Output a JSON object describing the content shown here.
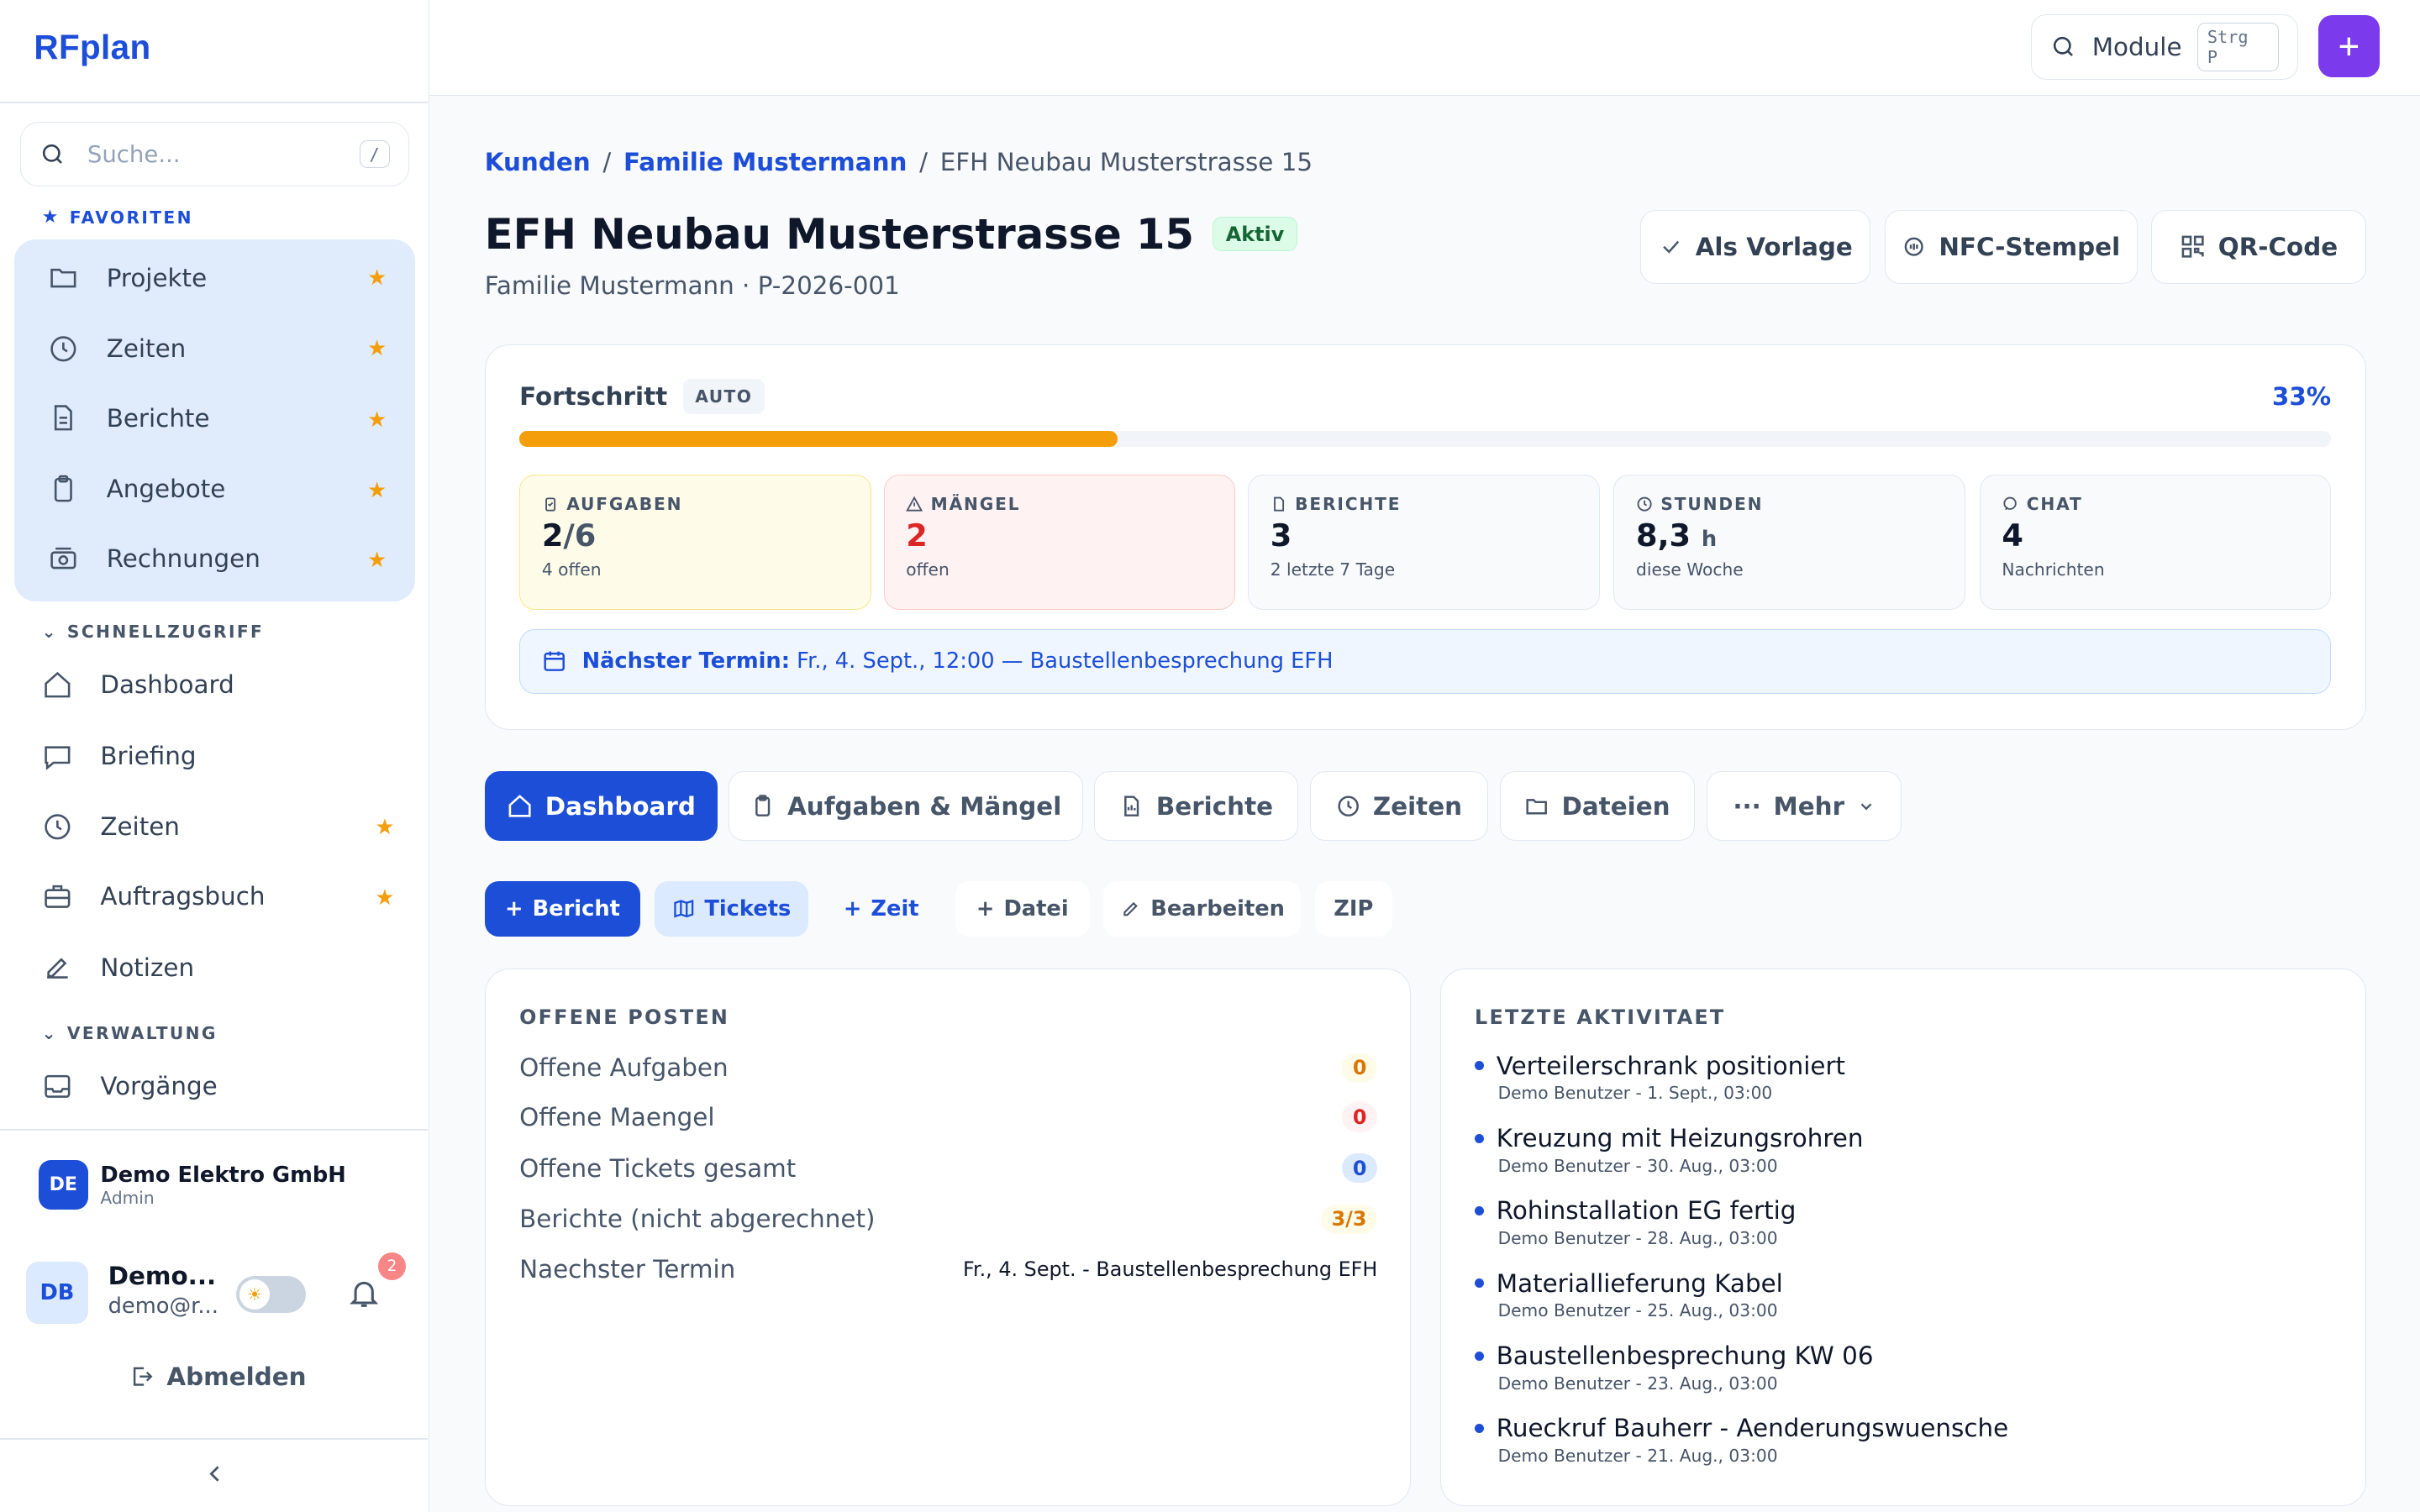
{
  "app": {
    "name": "RFplan"
  },
  "sidebar": {
    "search_placeholder": "Suche...",
    "search_shortcut": "/",
    "favorites_label": "FAVORITEN",
    "favorites": [
      {
        "label": "Projekte",
        "icon": "folder-icon"
      },
      {
        "label": "Zeiten",
        "icon": "clock-icon"
      },
      {
        "label": "Berichte",
        "icon": "file-icon"
      },
      {
        "label": "Angebote",
        "icon": "clipboard-icon"
      },
      {
        "label": "Rechnungen",
        "icon": "cash-icon"
      }
    ],
    "quick_label": "SCHNELLZUGRIFF",
    "quick": [
      {
        "label": "Dashboard",
        "icon": "home-icon",
        "starred": false
      },
      {
        "label": "Briefing",
        "icon": "chat-icon",
        "starred": false
      },
      {
        "label": "Zeiten",
        "icon": "clock-icon",
        "starred": true
      },
      {
        "label": "Auftragsbuch",
        "icon": "briefcase-icon",
        "starred": true
      },
      {
        "label": "Notizen",
        "icon": "edit-icon",
        "starred": false
      }
    ],
    "admin_label": "VERWALTUNG",
    "admin": [
      {
        "label": "Vorgänge",
        "icon": "inbox-icon"
      }
    ],
    "org": {
      "initials": "DE",
      "name": "Demo Elektro GmbH",
      "role": "Admin"
    },
    "user": {
      "initials": "DB",
      "name": "Demo...",
      "email": "demo@r...",
      "notifications": "2"
    },
    "logout_label": "Abmelden"
  },
  "topbar": {
    "module_label": "Module",
    "module_shortcut": "Strg P"
  },
  "breadcrumb": [
    "Kunden",
    "Familie Mustermann",
    "EFH Neubau Musterstrasse 15"
  ],
  "project": {
    "title": "EFH Neubau Musterstrasse 15",
    "status": "Aktiv",
    "subtitle": "Familie Mustermann · P-2026-001",
    "actions": [
      "Als Vorlage",
      "NFC-Stempel",
      "QR-Code"
    ]
  },
  "progress": {
    "label": "Fortschritt",
    "mode": "AUTO",
    "percent_label": "33%",
    "percent": 33,
    "accent": "#f59e0b"
  },
  "stats": [
    {
      "label": "AUFGABEN",
      "value": "2",
      "value_suffix": "/6",
      "sub": "4 offen",
      "icon": "clipboard-icon"
    },
    {
      "label": "MÄNGEL",
      "value": "2",
      "value_suffix": "",
      "sub": "offen",
      "icon": "warning-icon"
    },
    {
      "label": "BERICHTE",
      "value": "3",
      "value_suffix": "",
      "sub": "2 letzte 7 Tage",
      "icon": "file-icon"
    },
    {
      "label": "STUNDEN",
      "value": "8,3",
      "value_suffix": "h",
      "sub": "diese Woche",
      "icon": "clock-icon"
    },
    {
      "label": "CHAT",
      "value": "4",
      "value_suffix": "",
      "sub": "Nachrichten",
      "icon": "chat-icon"
    }
  ],
  "next_meeting": {
    "label": "Nächster Termin:",
    "text": "Fr., 4. Sept., 12:00 — Baustellenbesprechung EFH"
  },
  "tabs": [
    "Dashboard",
    "Aufgaben & Mängel",
    "Berichte",
    "Zeiten",
    "Dateien",
    "Mehr"
  ],
  "quick_actions": [
    "Bericht",
    "Tickets",
    "Zeit",
    "Datei",
    "Bearbeiten",
    "ZIP"
  ],
  "open_items": {
    "title": "OFFENE POSTEN",
    "rows": [
      {
        "label": "Offene Aufgaben",
        "value": "0"
      },
      {
        "label": "Offene Maengel",
        "value": "0"
      },
      {
        "label": "Offene Tickets gesamt",
        "value": "0"
      },
      {
        "label": "Berichte (nicht abgerechnet)",
        "value": "3/3"
      },
      {
        "label": "Naechster Termin",
        "value": "Fr., 4. Sept. - Baustellenbesprechung EFH"
      }
    ]
  },
  "activity": {
    "title": "LETZTE AKTIVITAET",
    "items": [
      {
        "title": "Verteilerschrank positioniert",
        "meta": "Demo Benutzer - 1. Sept., 03:00"
      },
      {
        "title": "Kreuzung mit Heizungsrohren",
        "meta": "Demo Benutzer - 30. Aug., 03:00"
      },
      {
        "title": "Rohinstallation EG fertig",
        "meta": "Demo Benutzer - 28. Aug., 03:00"
      },
      {
        "title": "Materiallieferung Kabel",
        "meta": "Demo Benutzer - 25. Aug., 03:00"
      },
      {
        "title": "Baustellenbesprechung KW 06",
        "meta": "Demo Benutzer - 23. Aug., 03:00"
      },
      {
        "title": "Rueckruf Bauherr - Aenderungswuensche",
        "meta": "Demo Benutzer - 21. Aug., 03:00"
      }
    ]
  },
  "colors": {
    "primary": "#1d4ed8",
    "accent_purple": "#7c3aed",
    "warning": "#f59e0b",
    "danger": "#dc2626"
  }
}
